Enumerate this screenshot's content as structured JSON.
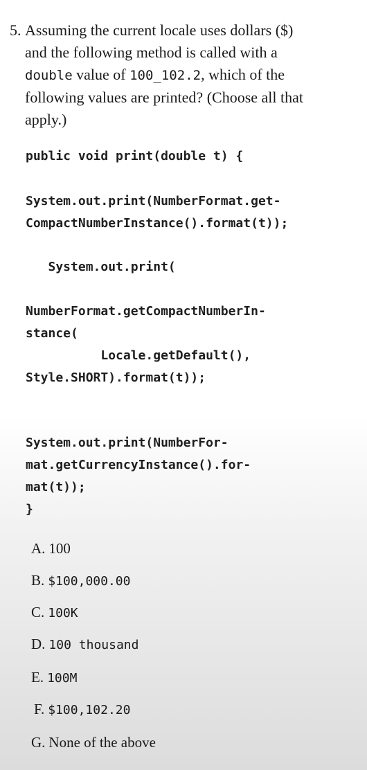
{
  "question": {
    "number": "5.",
    "line1": "Assuming the current locale uses dollars ($)",
    "line2": "and the following method is called with a",
    "line3_code": "double",
    "line3_mid": " value of ",
    "line3_value": "100_102.2",
    "line3_end": ", which of the",
    "line4": "following values are printed? (Choose all that",
    "line5": "apply.)"
  },
  "code": {
    "signature": "public void print(double t) {",
    "stmt1_a": "System.out.print(NumberFormat.get-",
    "stmt1_b": "CompactNumberInstance().format(t));",
    "stmt2_a": "   System.out.print(",
    "stmt2_b": "NumberFormat.getCompactNumberIn-",
    "stmt2_c": "stance(",
    "stmt2_d": "          Locale.getDefault(),",
    "stmt2_e": "Style.SHORT).format(t));",
    "stmt3_a": "System.out.print(NumberFor-",
    "stmt3_b": "mat.getCurrencyInstance().for-",
    "stmt3_c": "mat(t));",
    "close": "}"
  },
  "options": [
    {
      "letter": "A.",
      "value": "100",
      "style": "serif"
    },
    {
      "letter": "B.",
      "value": "$100,000.00",
      "style": "mono"
    },
    {
      "letter": "C.",
      "value": "100K",
      "style": "mono"
    },
    {
      "letter": "D.",
      "value": "100 thousand",
      "style": "mono"
    },
    {
      "letter": "E.",
      "value": "100M",
      "style": "mono"
    },
    {
      "letter": "F.",
      "value": "$100,102.20",
      "style": "mono"
    },
    {
      "letter": "G.",
      "value": "None of the above",
      "style": "serif"
    }
  ]
}
